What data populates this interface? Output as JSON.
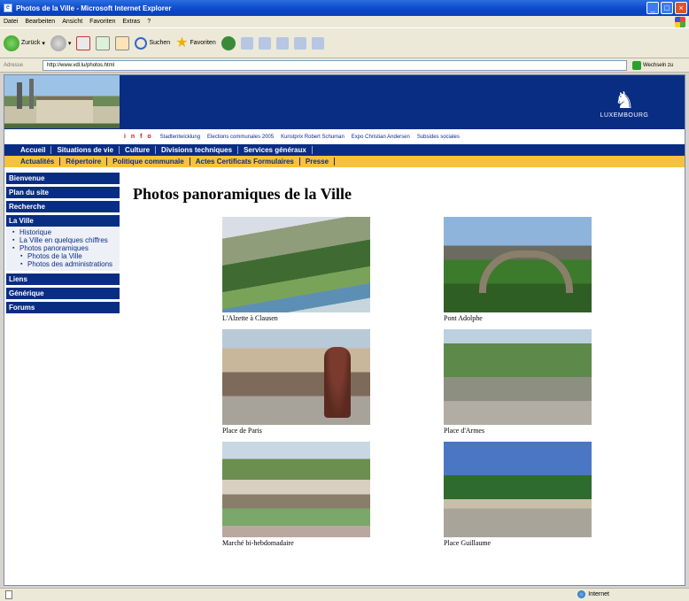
{
  "window": {
    "title": "Photos de la Ville - Microsoft Internet Explorer"
  },
  "menubar": {
    "items": [
      "Datei",
      "Bearbeiten",
      "Ansicht",
      "Favoriten",
      "Extras",
      "?"
    ]
  },
  "toolbar": {
    "back_label": "Zurück",
    "search_label": "Suchen",
    "favorites_label": "Favoriten"
  },
  "address": {
    "label": "Adresse",
    "url": "http://www.vdl.lu/photos.html",
    "go_label": "Wechseln zu"
  },
  "banner": {
    "logo_text": "LUXEMBOURG",
    "quicklinks_label": "i n f o",
    "quicklinks": [
      "Stadtentwicklung",
      "Elections communales 2005",
      "Kunstprix Robert Schuman",
      "Expo Christian Andersen",
      "Subsides sociales"
    ]
  },
  "nav_primary": [
    "Accueil",
    "Situations de vie",
    "Culture",
    "Divisions techniques",
    "Services généraux"
  ],
  "nav_secondary": [
    "Actualités",
    "Répertoire",
    "Politique communale",
    "Actes Certificats Formulaires",
    "Presse"
  ],
  "sidebar": {
    "bienvenue": "Bienvenue",
    "plan": "Plan du site",
    "recherche": "Recherche",
    "la_ville": "La Ville",
    "sub": {
      "historique": "Historique",
      "chiffres": "La Ville en quelques chiffres",
      "panoramiques": "Photos panoramiques",
      "photos_ville": "Photos de la Ville",
      "photos_admin": "Photos des administrations"
    },
    "liens": "Liens",
    "generique": "Générique",
    "forums": "Forums"
  },
  "main": {
    "title": "Photos panoramiques de la Ville",
    "photos": [
      {
        "caption": "L'Alzette à Clausen"
      },
      {
        "caption": "Pont Adolphe"
      },
      {
        "caption": "Place de Paris"
      },
      {
        "caption": "Place d'Armes"
      },
      {
        "caption": "Marché bi-hebdomadaire"
      },
      {
        "caption": "Place Guillaume"
      }
    ]
  },
  "statusbar": {
    "zone": "Internet"
  }
}
